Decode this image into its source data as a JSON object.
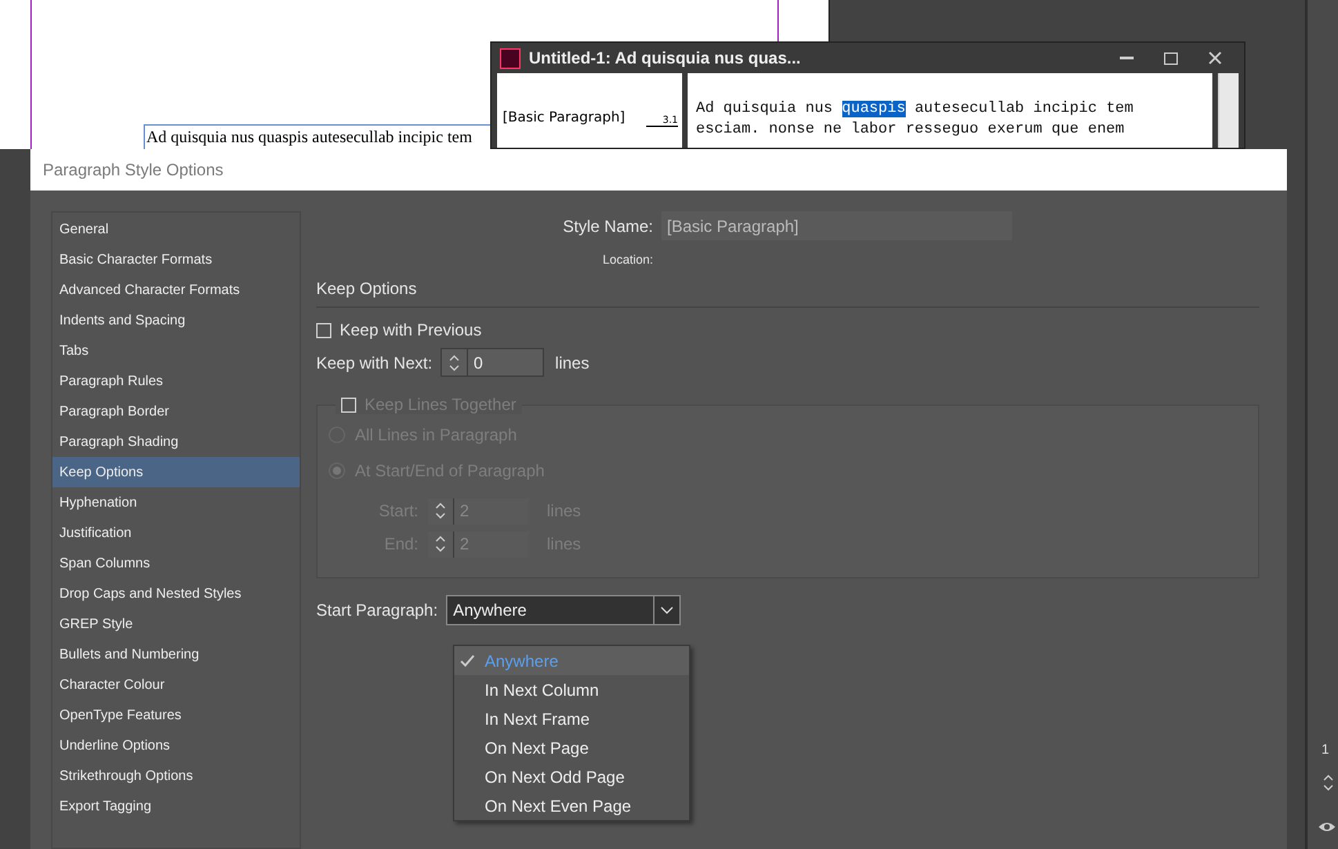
{
  "document": {
    "text": "Ad quisquia nus quaspis autesecullab incipic tem"
  },
  "story_editor": {
    "title": "Untitled-1: Ad quisquia nus quas...",
    "style_column": "[Basic Paragraph]",
    "depth": "3.1",
    "line_1": [
      {
        "text": "Ad quisquia nus ",
        "selected": false
      },
      {
        "text": "quaspis",
        "selected": true
      },
      {
        "text": " autesecullab incipic tem",
        "selected": false
      }
    ],
    "line_2": "esciam. nonse ne labor resseguo exerum que enem"
  },
  "dialog": {
    "title": "Paragraph Style Options",
    "sidebar": {
      "items": [
        {
          "label": "General",
          "selected": false
        },
        {
          "label": "Basic Character Formats",
          "selected": false
        },
        {
          "label": "Advanced Character Formats",
          "selected": false
        },
        {
          "label": "Indents and Spacing",
          "selected": false
        },
        {
          "label": "Tabs",
          "selected": false
        },
        {
          "label": "Paragraph Rules",
          "selected": false
        },
        {
          "label": "Paragraph Border",
          "selected": false
        },
        {
          "label": "Paragraph Shading",
          "selected": false
        },
        {
          "label": "Keep Options",
          "selected": true
        },
        {
          "label": "Hyphenation",
          "selected": false
        },
        {
          "label": "Justification",
          "selected": false
        },
        {
          "label": "Span Columns",
          "selected": false
        },
        {
          "label": "Drop Caps and Nested Styles",
          "selected": false
        },
        {
          "label": "GREP Style",
          "selected": false
        },
        {
          "label": "Bullets and Numbering",
          "selected": false
        },
        {
          "label": "Character Colour",
          "selected": false
        },
        {
          "label": "OpenType Features",
          "selected": false
        },
        {
          "label": "Underline Options",
          "selected": false
        },
        {
          "label": "Strikethrough Options",
          "selected": false
        },
        {
          "label": "Export Tagging",
          "selected": false
        }
      ]
    },
    "style_name": {
      "label": "Style Name:",
      "value": "[Basic Paragraph]"
    },
    "location": {
      "label": "Location:"
    },
    "section_title": "Keep Options",
    "keep_with_previous": {
      "label": "Keep with Previous",
      "checked": false
    },
    "keep_with_next": {
      "label": "Keep with Next:",
      "value": "0",
      "unit": "lines"
    },
    "keep_lines_together": {
      "label": "Keep Lines Together",
      "checked": false,
      "disabled": true,
      "options": [
        {
          "label": "All Lines in Paragraph",
          "selected": false
        },
        {
          "label": "At Start/End of Paragraph",
          "selected": true
        }
      ],
      "start": {
        "label": "Start:",
        "value": "2",
        "unit": "lines"
      },
      "end": {
        "label": "End:",
        "value": "2",
        "unit": "lines"
      }
    },
    "start_paragraph": {
      "label": "Start Paragraph:",
      "value": "Anywhere",
      "expanded": true,
      "options": [
        {
          "label": "Anywhere",
          "selected": true
        },
        {
          "label": "In Next Column",
          "selected": false
        },
        {
          "label": "In Next Frame",
          "selected": false
        },
        {
          "label": "On Next Page",
          "selected": false
        },
        {
          "label": "On Next Odd Page",
          "selected": false
        },
        {
          "label": "On Next Even Page",
          "selected": false
        }
      ]
    }
  },
  "side_panel": {
    "text": "1"
  }
}
